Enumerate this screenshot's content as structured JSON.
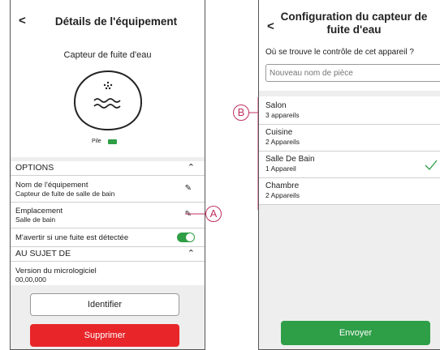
{
  "left_screen": {
    "back_label": "<",
    "title": "Détails de l'équipement",
    "device_name": "Capteur de fuite d'eau",
    "battery_label": "Pile",
    "options": {
      "header": "OPTIONS",
      "rows": [
        {
          "label": "Nom de l'équipement",
          "value": "Capteur de fuite de salle de bain"
        },
        {
          "label": "Emplacement",
          "value": "Salle de bain"
        }
      ],
      "toggle_label": "M'avertir si une fuite est détectée"
    },
    "about": {
      "header": "AU SUJET DE",
      "firmware_label": "Version du micrologiciel",
      "firmware_value": "00,00,000"
    },
    "identify_button": "Identifier",
    "delete_button": "Supprimer"
  },
  "right_screen": {
    "back_label": "<",
    "title_line1": "Configuration du capteur de",
    "title_line2": "fuite d'eau",
    "question": "Où se trouve le contrôle de cet appareil ?",
    "room_input_placeholder": "Nouveau nom de pièce",
    "rooms": [
      {
        "name": "Salon",
        "count": "3 appareils"
      },
      {
        "name": "Cuisine",
        "count": "2 Appareils"
      },
      {
        "name": "Salle De Bain",
        "count": "1 Appareil"
      },
      {
        "name": "Chambre",
        "count": "2 Appareils"
      }
    ],
    "send_button": "Envoyer"
  },
  "callouts": {
    "a": "A",
    "b": "B"
  },
  "colors": {
    "toggle": "#2f9e45",
    "delete": "#e8262a",
    "send": "#2e9e47",
    "callout": "#c03060"
  }
}
